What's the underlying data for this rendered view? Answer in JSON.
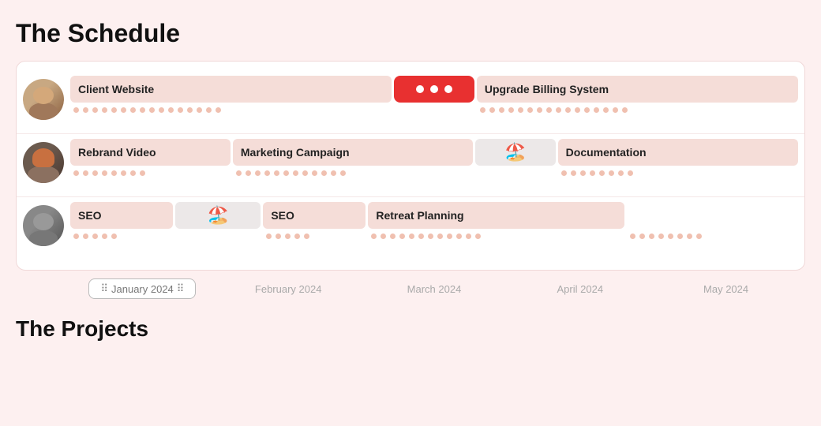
{
  "page": {
    "title": "The Schedule",
    "subtitle": "The Projects"
  },
  "timeline": {
    "months": [
      "January 2024",
      "February 2024",
      "March 2024",
      "April 2024",
      "May 2024"
    ],
    "highlight_month": "January 2024"
  },
  "rows": [
    {
      "id": "row1",
      "avatar_label": "person-1",
      "tasks": [
        {
          "label": "Client Website",
          "span": 4,
          "type": "bar"
        },
        {
          "label": "",
          "span": 1,
          "type": "red-dots"
        },
        {
          "label": "Upgrade Billing System",
          "span": 4,
          "type": "bar"
        }
      ]
    },
    {
      "id": "row2",
      "avatar_label": "person-2",
      "tasks": [
        {
          "label": "Rebrand Video",
          "span": 2,
          "type": "bar"
        },
        {
          "label": "Marketing Campaign",
          "span": 3,
          "type": "bar"
        },
        {
          "label": "",
          "span": 1,
          "type": "vacation"
        },
        {
          "label": "Documentation",
          "span": 2,
          "type": "bar"
        }
      ]
    },
    {
      "id": "row3",
      "avatar_label": "person-3",
      "tasks": [
        {
          "label": "SEO",
          "span": 1,
          "type": "bar"
        },
        {
          "label": "",
          "span": 1,
          "type": "vacation"
        },
        {
          "label": "SEO",
          "span": 1,
          "type": "bar"
        },
        {
          "label": "Retreat Planning",
          "span": 3,
          "type": "bar"
        },
        {
          "label": "",
          "span": 2,
          "type": "dots-only"
        }
      ]
    }
  ],
  "icons": {
    "beach": "🏖️",
    "drag_handle": "⠿"
  }
}
